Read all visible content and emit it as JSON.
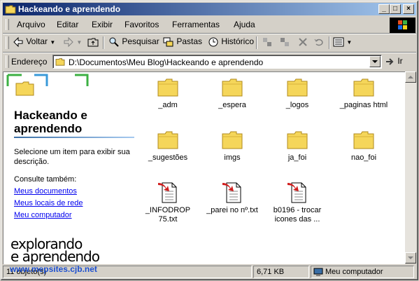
{
  "window": {
    "title": "Hackeando e aprendendo",
    "controls": {
      "minimize": "_",
      "maximize": "□",
      "close": "×"
    }
  },
  "menu": [
    "Arquivo",
    "Editar",
    "Exibir",
    "Favoritos",
    "Ferramentas",
    "Ajuda"
  ],
  "toolbar": {
    "back": "Voltar",
    "search": "Pesquisar",
    "folders": "Pastas",
    "history": "Histórico"
  },
  "address": {
    "label": "Endereço",
    "path": "D:\\Documentos\\Meu Blog\\Hackeando e aprendendo",
    "go": "Ir"
  },
  "panel": {
    "title": "Hackeando e aprendendo",
    "description": "Selecione um item para exibir sua descrição.",
    "see_also": "Consulte também:",
    "links": [
      "Meus documentos",
      "Meus locais de rede",
      "Meu computador"
    ]
  },
  "watermark": {
    "line1": "explorando",
    "line2": "e aprendendo",
    "url": "www.mepsites.cjb.net"
  },
  "items": [
    {
      "name": "_adm",
      "type": "folder"
    },
    {
      "name": "_espera",
      "type": "folder"
    },
    {
      "name": "_logos",
      "type": "folder"
    },
    {
      "name": "_paginas html",
      "type": "folder"
    },
    {
      "name": "_sugestões",
      "type": "folder"
    },
    {
      "name": "imgs",
      "type": "folder"
    },
    {
      "name": "ja_foi",
      "type": "folder"
    },
    {
      "name": "nao_foi",
      "type": "folder"
    },
    {
      "name": "_INFODROP 75.txt",
      "type": "txt"
    },
    {
      "name": "_parei no nº.txt",
      "type": "txt"
    },
    {
      "name": "b0196 - trocar icones das ...",
      "type": "txt"
    }
  ],
  "status": {
    "count": "11 objeto(s)",
    "size": "6,71 KB",
    "zone": "Meu computador"
  },
  "colors": {
    "titlebar_start": "#0a246a",
    "titlebar_end": "#a6caf0",
    "folder": "#f5d65a",
    "link": "#0000ee"
  }
}
